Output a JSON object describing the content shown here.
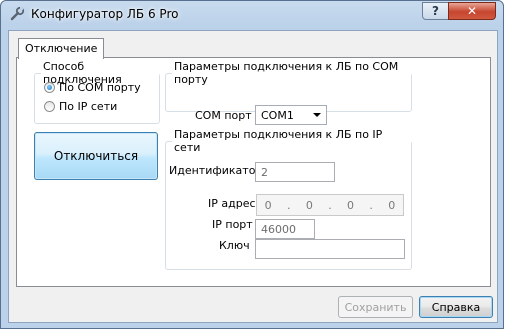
{
  "window": {
    "title": "Конфигуратор ЛБ 6 Pro",
    "help_glyph": "?",
    "close_glyph": "✕"
  },
  "tabs": [
    {
      "label": "Отключение",
      "selected": true
    }
  ],
  "connection_method": {
    "legend": "Способ подключения",
    "options": [
      {
        "label": "По COM порту",
        "selected": true
      },
      {
        "label": "По IP сети",
        "selected": false
      }
    ]
  },
  "disconnect_button": {
    "label": "Отключиться"
  },
  "com_params": {
    "legend": "Параметры подключения к ЛБ по COM порту",
    "port_label": "COM порт",
    "port_value": "COM1"
  },
  "ip_params": {
    "legend": "Параметры подключения к ЛБ по IP сети",
    "id_label": "Идентификатор",
    "id_value": "2",
    "address_label": "IP адрес",
    "address_octets": [
      "0",
      "0",
      "0",
      "0"
    ],
    "port_label": "IP порт",
    "port_value": "46000",
    "key_label": "Ключ",
    "key_value": ""
  },
  "footer": {
    "save_label": "Сохранить",
    "help_label": "Справка"
  },
  "colors": {
    "accent": "#3c7fb1",
    "titlebar": "#bcd2ea",
    "close": "#c7462f"
  }
}
